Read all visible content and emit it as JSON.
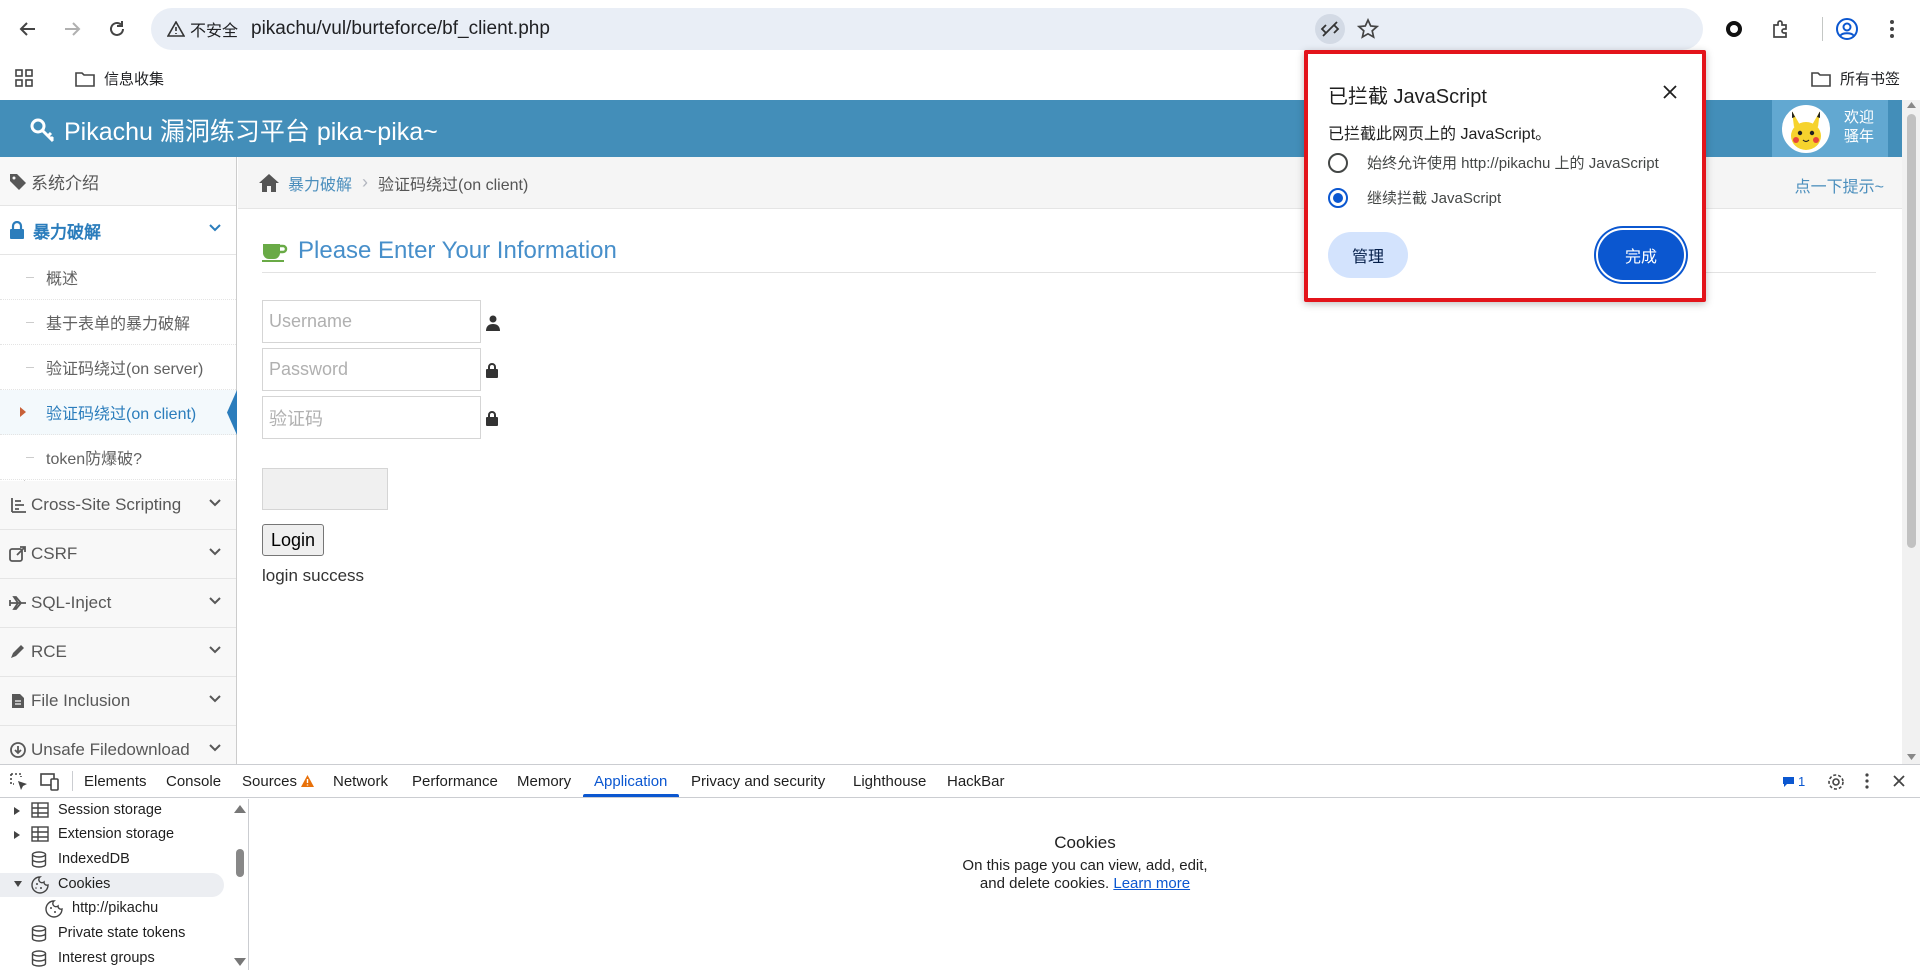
{
  "browser": {
    "security_label": "不安全",
    "url": "pikachu/vul/burteforce/bf_client.php",
    "bookmarks": {
      "folder": "信息收集",
      "all_bookmarks": "所有书签"
    }
  },
  "site": {
    "title": "Pikachu 漏洞练习平台 pika~pika~",
    "welcome": [
      "欢迎",
      "骚年"
    ]
  },
  "sidebar": {
    "items": [
      {
        "label": "系统介绍",
        "icon": "tags-icon"
      },
      {
        "label": "暴力破解",
        "icon": "lock-icon",
        "active": true
      },
      {
        "label": "Cross-Site Scripting",
        "icon": "sliders-icon"
      },
      {
        "label": "CSRF",
        "icon": "share-icon"
      },
      {
        "label": "SQL-Inject",
        "icon": "plane-icon"
      },
      {
        "label": "RCE",
        "icon": "pencil-icon"
      },
      {
        "label": "File Inclusion",
        "icon": "file-icon"
      },
      {
        "label": "Unsafe Filedownload",
        "icon": "download-icon"
      }
    ],
    "submenu": [
      "概述",
      "基于表单的暴力破解",
      "验证码绕过(on server)",
      "验证码绕过(on client)",
      "token防爆破?"
    ]
  },
  "breadcrumb": {
    "parent": "暴力破解",
    "current": "验证码绕过(on client)",
    "hint": "点一下提示~"
  },
  "form": {
    "title": "Please Enter Your Information",
    "username_placeholder": "Username",
    "password_placeholder": "Password",
    "captcha_placeholder": "验证码",
    "login_label": "Login",
    "message": "login success"
  },
  "popup": {
    "title": "已拦截 JavaScript",
    "description": "已拦截此网页上的 JavaScript。",
    "option_allow": "始终允许使用 http://pikachu 上的 JavaScript",
    "option_block": "继续拦截 JavaScript",
    "selected": "option_block",
    "manage_label": "管理",
    "done_label": "完成",
    "accent": "#0b57d0",
    "highlight_border": "#e3141b"
  },
  "devtools": {
    "tabs": [
      "Elements",
      "Console",
      "Sources",
      "Network",
      "Performance",
      "Memory",
      "Application",
      "Privacy and security",
      "Lighthouse",
      "HackBar"
    ],
    "active_tab": "Application",
    "issues_count": "1",
    "tree": [
      {
        "label": "Session storage",
        "icon": "table-icon",
        "expandable": true
      },
      {
        "label": "Extension storage",
        "icon": "table-icon",
        "expandable": true
      },
      {
        "label": "IndexedDB",
        "icon": "database-icon"
      },
      {
        "label": "Cookies",
        "icon": "cookie-icon",
        "expanded": true,
        "selected": true
      },
      {
        "label": "http://pikachu",
        "icon": "cookie-icon",
        "child": true
      },
      {
        "label": "Private state tokens",
        "icon": "database-icon"
      },
      {
        "label": "Interest groups",
        "icon": "database-icon"
      }
    ],
    "panel": {
      "title": "Cookies",
      "description": "On this page you can view, add, edit, and delete cookies.",
      "learn_more": "Learn more"
    }
  }
}
